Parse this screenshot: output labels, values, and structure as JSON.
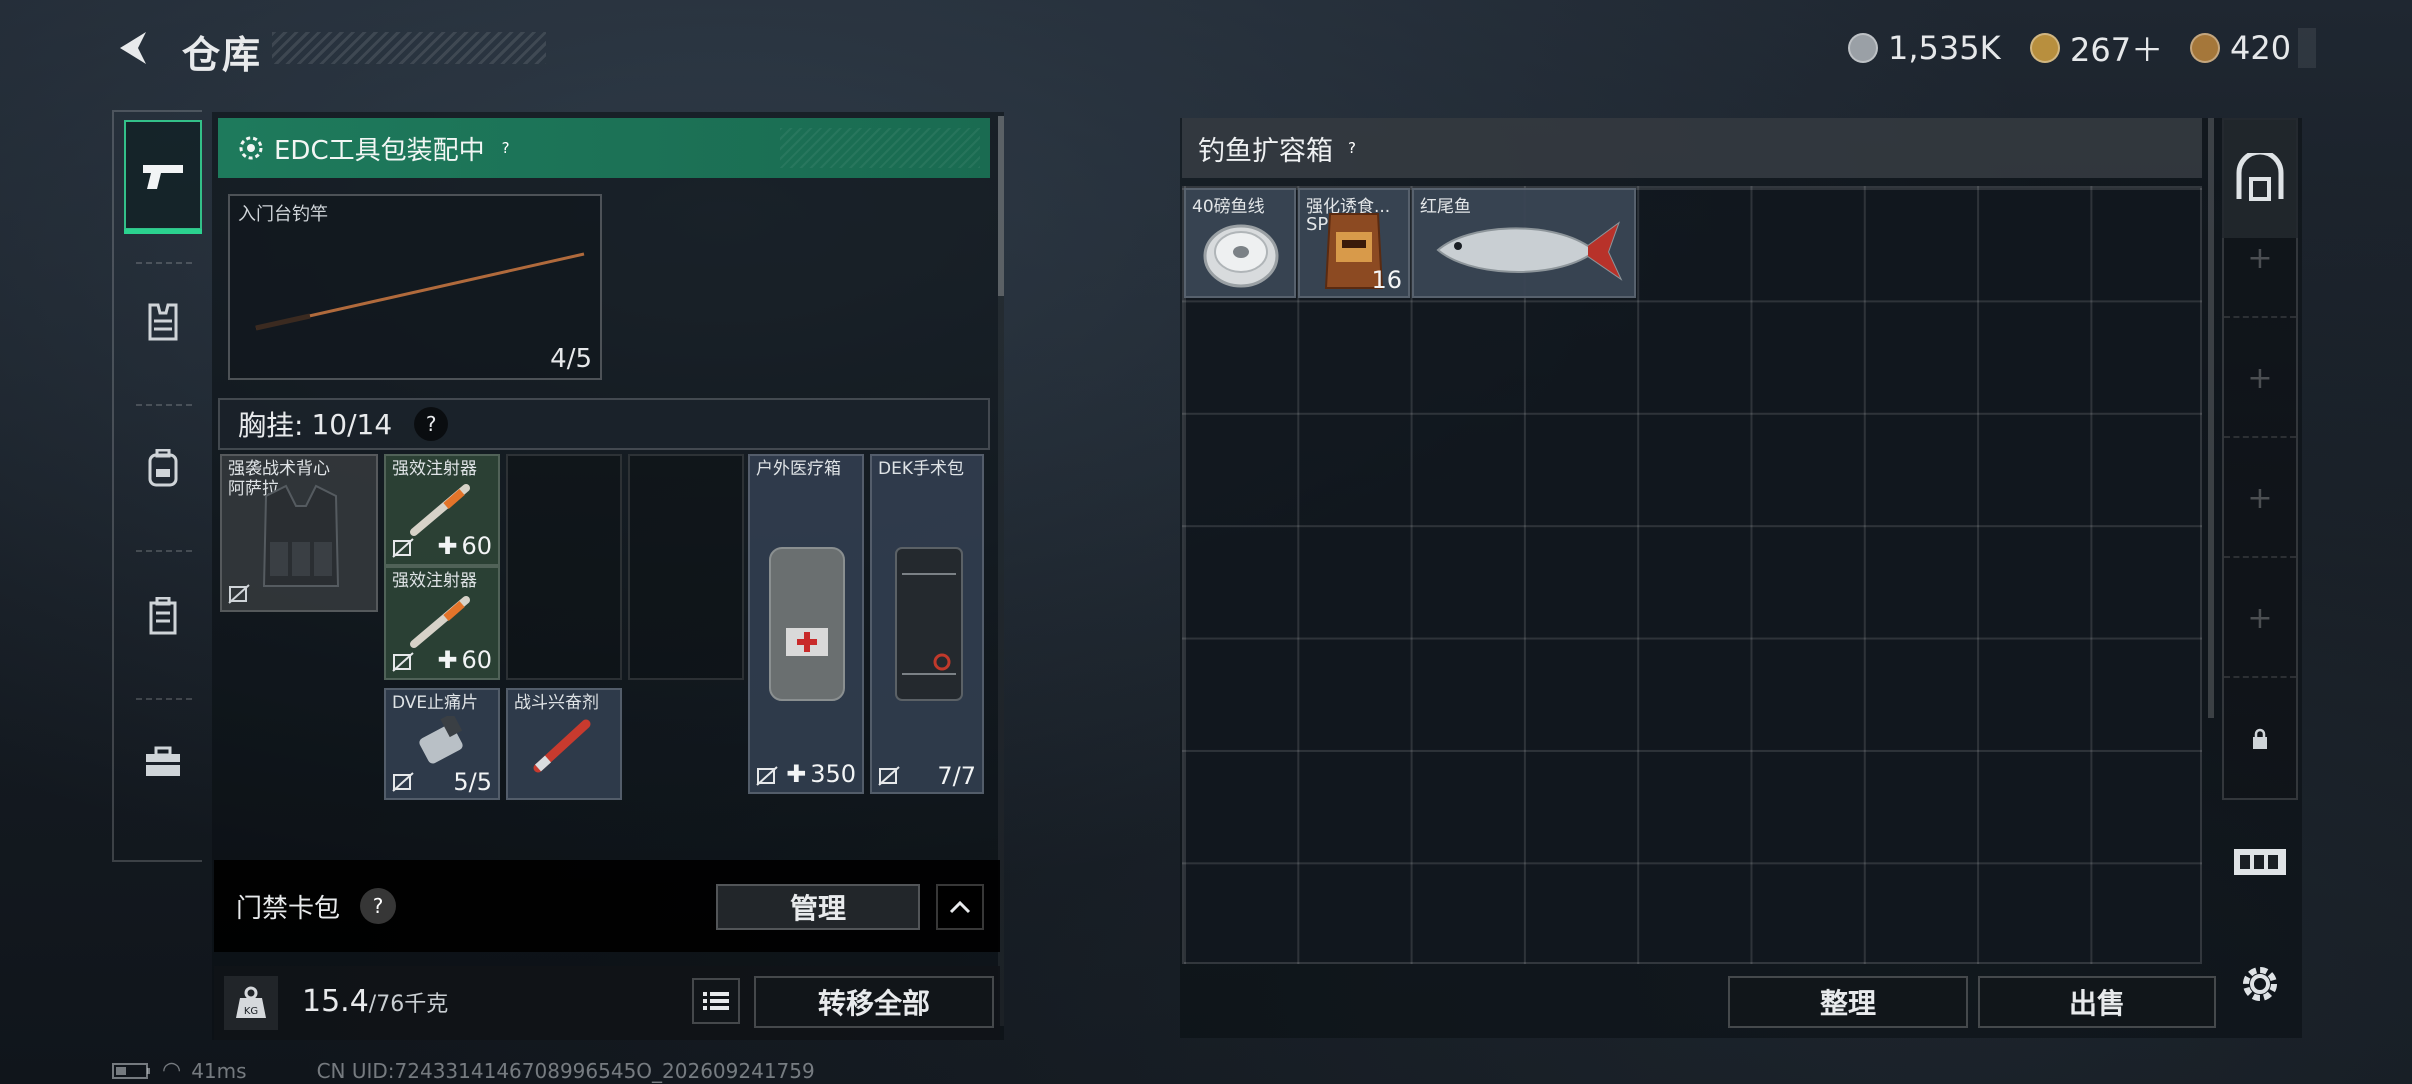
{
  "header": {
    "title": "仓库",
    "currencies": [
      {
        "icon": "silver-coin-icon",
        "value": "1,535K",
        "color": "#b8bcc0"
      },
      {
        "icon": "gold-coin-icon",
        "value": "267＋",
        "color": "#c9a55a"
      },
      {
        "icon": "bronze-coin-icon",
        "value": "420",
        "color": "#b98c4e"
      }
    ]
  },
  "rail": {
    "items": [
      {
        "name": "weapon",
        "icon": "pistol-icon",
        "active": true
      },
      {
        "name": "vest",
        "icon": "vest-icon",
        "active": false
      },
      {
        "name": "backpack",
        "icon": "backpack-icon",
        "active": false
      },
      {
        "name": "case",
        "icon": "case-icon",
        "active": false
      },
      {
        "name": "toolbox",
        "icon": "toolbox-icon",
        "active": false
      }
    ]
  },
  "left": {
    "edc_label": "EDC工具包装配中",
    "edc_help": "?",
    "rod": {
      "name": "入门台钓竿",
      "count": "4/5"
    },
    "chest": {
      "label": "胸挂:",
      "count": "10/14",
      "help": "?"
    },
    "items": {
      "vest": {
        "name": "强袭战术背心\n阿萨拉"
      },
      "syringe1": {
        "name": "强效注射器",
        "value": "60"
      },
      "syringe2": {
        "name": "强效注射器",
        "value": "60"
      },
      "painkiller": {
        "name": "DVE止痛片",
        "count": "5/5"
      },
      "stimulant": {
        "name": "战斗兴奋剂"
      },
      "medkit": {
        "name": "户外医疗箱",
        "value": "350"
      },
      "surgical": {
        "name": "DEK手术包",
        "count": "7/7"
      }
    },
    "card": {
      "label": "门禁卡包",
      "help": "?",
      "manage": "管理"
    },
    "weight": {
      "current": "15.4",
      "max": "/76千克",
      "icon_label": "KG"
    },
    "transfer": "转移全部"
  },
  "status": {
    "ping": "41ms",
    "uid": "CN UID:7243314146708996545O_202609241759"
  },
  "right": {
    "box_title": "钓鱼扩容箱",
    "box_help": "?",
    "items": [
      {
        "name": "40磅鱼线",
        "count": ""
      },
      {
        "name": "强化诱食...",
        "subname": "SP",
        "count": "16"
      },
      {
        "name": "红尾鱼",
        "count": ""
      }
    ],
    "sort": "整理",
    "sell": "出售"
  }
}
